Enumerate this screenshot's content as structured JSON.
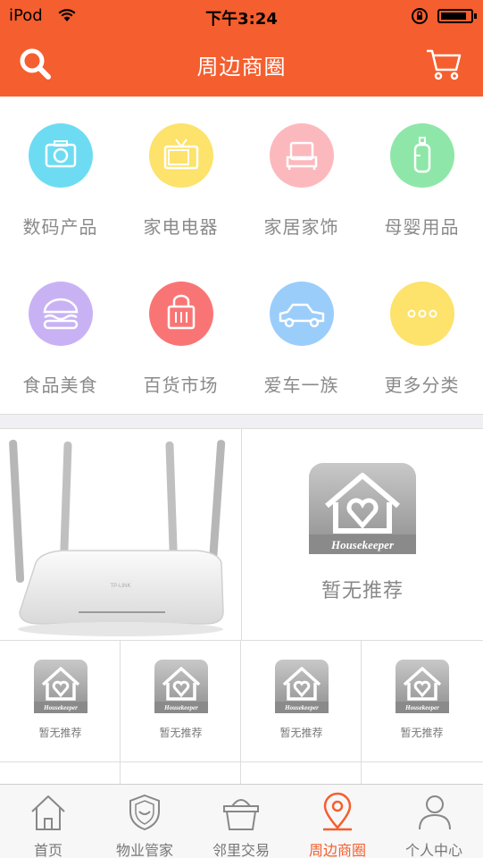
{
  "status_bar": {
    "carrier": "iPod",
    "time": "下午3:24"
  },
  "header": {
    "title": "周边商圈",
    "search_icon": "search-icon",
    "cart_icon": "cart-icon"
  },
  "categories": [
    {
      "label": "数码产品",
      "icon": "camera-icon",
      "color": "#6ddcf3"
    },
    {
      "label": "家电电器",
      "icon": "tv-icon",
      "color": "#fde26b"
    },
    {
      "label": "家居家饰",
      "icon": "bed-icon",
      "color": "#fcb9bd"
    },
    {
      "label": "母婴用品",
      "icon": "baby-bottle-icon",
      "color": "#8ee7a8"
    },
    {
      "label": "食品美食",
      "icon": "burger-icon",
      "color": "#c9b2f4"
    },
    {
      "label": "百货市场",
      "icon": "shopping-bag-icon",
      "color": "#f97575"
    },
    {
      "label": "爱车一族",
      "icon": "car-icon",
      "color": "#9bcdfb"
    },
    {
      "label": "更多分类",
      "icon": "more-icon",
      "color": "#fde26b"
    }
  ],
  "feature": {
    "no_recommend": "暂无推荐",
    "logo_text": "Housekeeper",
    "router_brand": "TP-LINK"
  },
  "recommend_grid": [
    {
      "text": "暂无推荐",
      "logo_text": "Housekeeper"
    },
    {
      "text": "暂无推荐",
      "logo_text": "Housekeeper"
    },
    {
      "text": "暂无推荐",
      "logo_text": "Housekeeper"
    },
    {
      "text": "暂无推荐",
      "logo_text": "Housekeeper"
    }
  ],
  "tabbar": {
    "active": 3,
    "items": [
      {
        "label": "首页",
        "icon": "home-icon"
      },
      {
        "label": "物业管家",
        "icon": "shield-icon"
      },
      {
        "label": "邻里交易",
        "icon": "basket-icon"
      },
      {
        "label": "周边商圈",
        "icon": "location-pin-icon"
      },
      {
        "label": "个人中心",
        "icon": "person-icon"
      }
    ]
  },
  "colors": {
    "brand": "#f55e2e",
    "background": "#efeff4",
    "text_gray": "#8a8a8a"
  }
}
